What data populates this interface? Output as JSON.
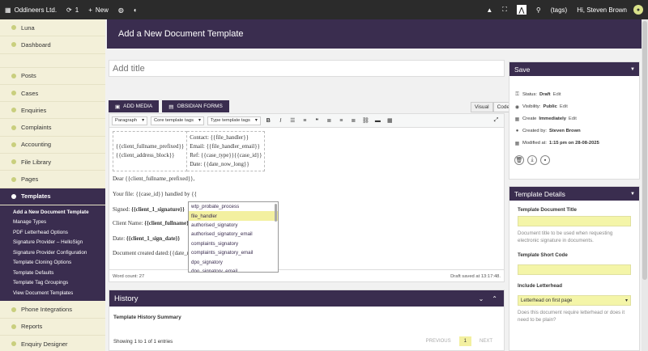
{
  "topbar": {
    "site": "Oddineers Ltd.",
    "updates_count": "1",
    "new_label": "New",
    "tags_label": "(tags)",
    "greeting": "Hi, Steven Brown"
  },
  "sidebar": {
    "items": [
      {
        "label": "Luna"
      },
      {
        "label": "Dashboard"
      },
      {
        "label": "Posts"
      },
      {
        "label": "Cases"
      },
      {
        "label": "Enquiries"
      },
      {
        "label": "Complaints"
      },
      {
        "label": "Accounting"
      },
      {
        "label": "File Library"
      },
      {
        "label": "Pages"
      },
      {
        "label": "Templates"
      },
      {
        "label": "Phone Integrations"
      },
      {
        "label": "Reports"
      },
      {
        "label": "Enquiry Designer"
      }
    ],
    "submenu": [
      "Add a New Document Template",
      "Manage Types",
      "PDF Letterhead Options",
      "Signature Provider – HelloSign",
      "Signature Provider Configuration",
      "Template Cloning Options",
      "Template Defaults",
      "Template Tag Groupings",
      "View Document Templates"
    ]
  },
  "header": {
    "title": "Add a New Document Template"
  },
  "editor": {
    "title_placeholder": "Add title",
    "add_media": "ADD MEDIA",
    "obsidian_forms": "OBSIDIAN FORMS",
    "tab_visual": "Visual",
    "tab_code": "Code",
    "format_select": "Paragraph",
    "core_tags_select": "Core template tags",
    "type_tags_select": "Type template tags",
    "table_left": [
      "{{client_fullname_prefixed}}",
      "{{client_address_block}}"
    ],
    "table_right": [
      "Contact: {{file_handler}}",
      "Email: {{file_handler_email}}",
      "Ref: {{case_type}}{{case_id}}",
      "Date: {{date_now_long}}"
    ],
    "dear_line": "Dear {{client_fullname_prefixed}},",
    "your_file_line": "Your file: {{case_id}} handled by {{",
    "signed_label": "Signed: ",
    "signed_tag": "{{client_1_signature}}",
    "client_name_label": "Client Name: ",
    "client_name_tag": "{{client_fullname}}",
    "date_label": "Date: ",
    "date_tag": "{{client_1_sign_date}}",
    "created_line": "Document created dated:{{date_n",
    "word_count": "Word count: 27",
    "draft_saved": "Draft saved at 13:17:48."
  },
  "autocomplete": {
    "items": [
      "wtp_probate_process",
      "file_handler",
      "authorised_signatory",
      "authorised_signatory_email",
      "complaints_signatory",
      "complaints_signatory_email",
      "dpo_signatory",
      "dpo_signatory_email"
    ],
    "selected_index": 1
  },
  "history": {
    "title": "History",
    "subtitle": "Template History Summary",
    "showing": "Showing 1 to 1 of 1 entries",
    "previous": "PREVIOUS",
    "page": "1",
    "next": "NEXT"
  },
  "save": {
    "title": "Save",
    "status_label": "Status:",
    "status_value": "Draft",
    "status_edit": "Edit",
    "visibility_label": "Visibility:",
    "visibility_value": "Public",
    "visibility_edit": "Edit",
    "create_label": "Create",
    "create_value": "Immediately",
    "create_edit": "Edit",
    "created_by_label": "Created by:",
    "created_by_value": "Steven Brown",
    "modified_label": "Modified at:",
    "modified_value": "1:15 pm on 28-08-2025"
  },
  "details": {
    "title": "Template Details",
    "doc_title_label": "Template Document Title",
    "doc_title_help": "Document title to be used when requesting electronic signature in documents.",
    "short_code_label": "Template Short Code",
    "letterhead_label": "Include Letterhead",
    "letterhead_value": "Letterhead on first page",
    "letterhead_help": "Does this document require letterhead or does it need to be plain?"
  },
  "colors": {
    "primary": "#3a2d4f",
    "sidebar_bg": "#f3f0d9",
    "highlight": "#f4f5a8",
    "topbar": "#2b2b2b"
  }
}
